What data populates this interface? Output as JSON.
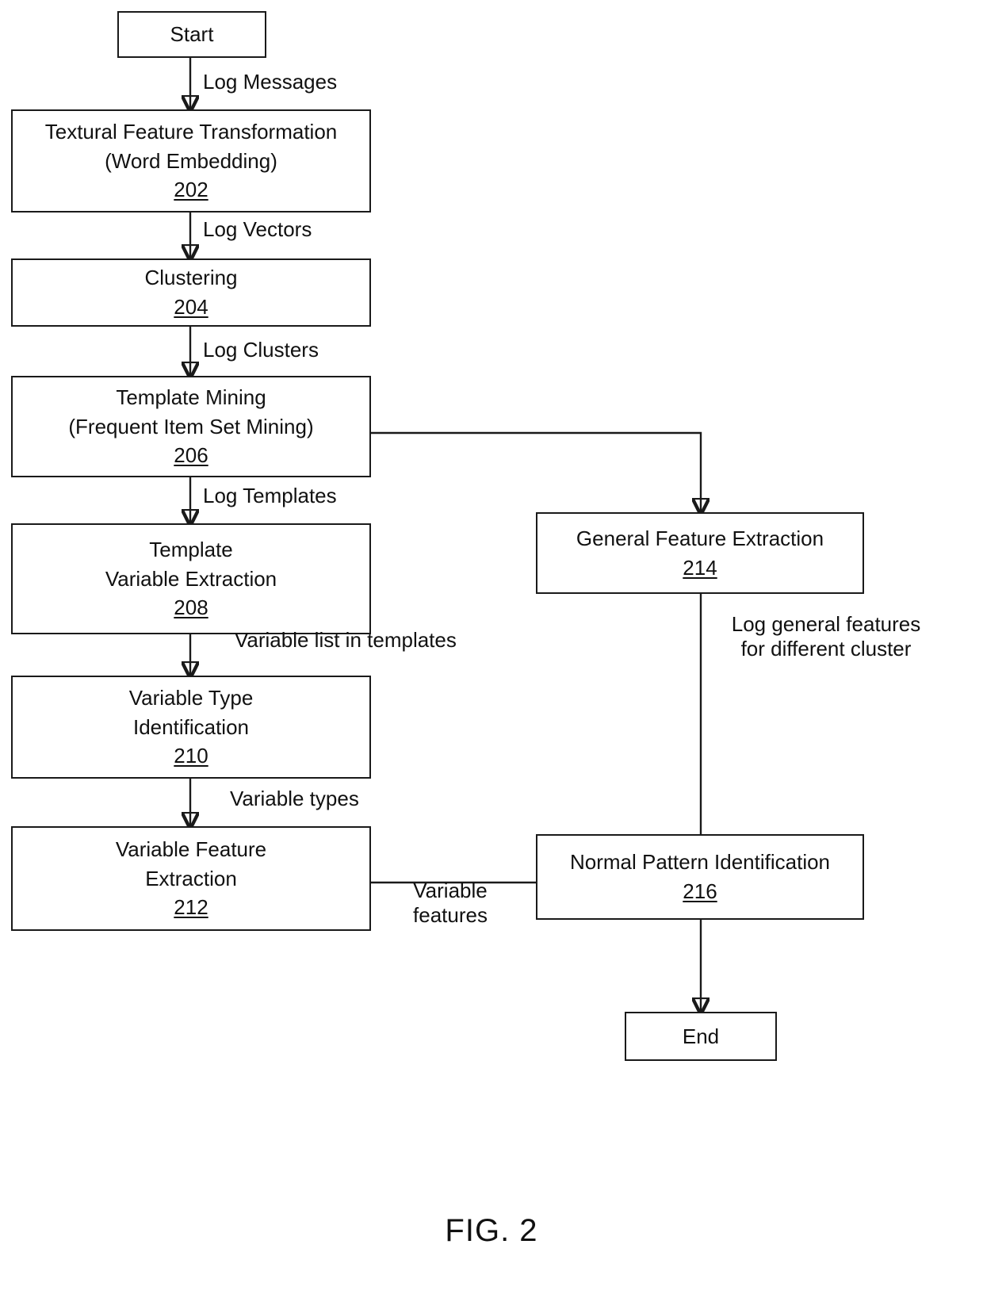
{
  "figure": {
    "caption": "FIG. 2"
  },
  "nodes": {
    "start": {
      "label": "Start"
    },
    "textural_feature_transformation": {
      "line1": "Textural Feature Transformation",
      "line2": "(Word Embedding)",
      "ref": "202"
    },
    "clustering": {
      "line1": "Clustering",
      "ref": "204"
    },
    "template_mining": {
      "line1": "Template Mining",
      "line2": "(Frequent Item Set Mining)",
      "ref": "206"
    },
    "template_variable_extraction": {
      "line1": "Template",
      "line2": "Variable Extraction",
      "ref": "208"
    },
    "variable_type_identification": {
      "line1": "Variable Type",
      "line2": "Identification",
      "ref": "210"
    },
    "variable_feature_extraction": {
      "line1": "Variable Feature",
      "line2": "Extraction",
      "ref": "212"
    },
    "general_feature_extraction": {
      "line1": "General Feature Extraction",
      "ref": "214"
    },
    "normal_pattern_identification": {
      "line1": "Normal Pattern Identification",
      "ref": "216"
    },
    "end": {
      "label": "End"
    }
  },
  "edge_labels": {
    "log_messages": "Log Messages",
    "log_vectors": "Log Vectors",
    "log_clusters": "Log Clusters",
    "log_templates": "Log Templates",
    "variable_list_in_templates": "Variable list in templates",
    "variable_types": "Variable types",
    "variable_features": "Variable\nfeatures",
    "log_general_features": "Log general features\nfor different cluster"
  },
  "colors": {
    "stroke": "#1a1a1a",
    "background": "#ffffff",
    "text": "#111111"
  }
}
